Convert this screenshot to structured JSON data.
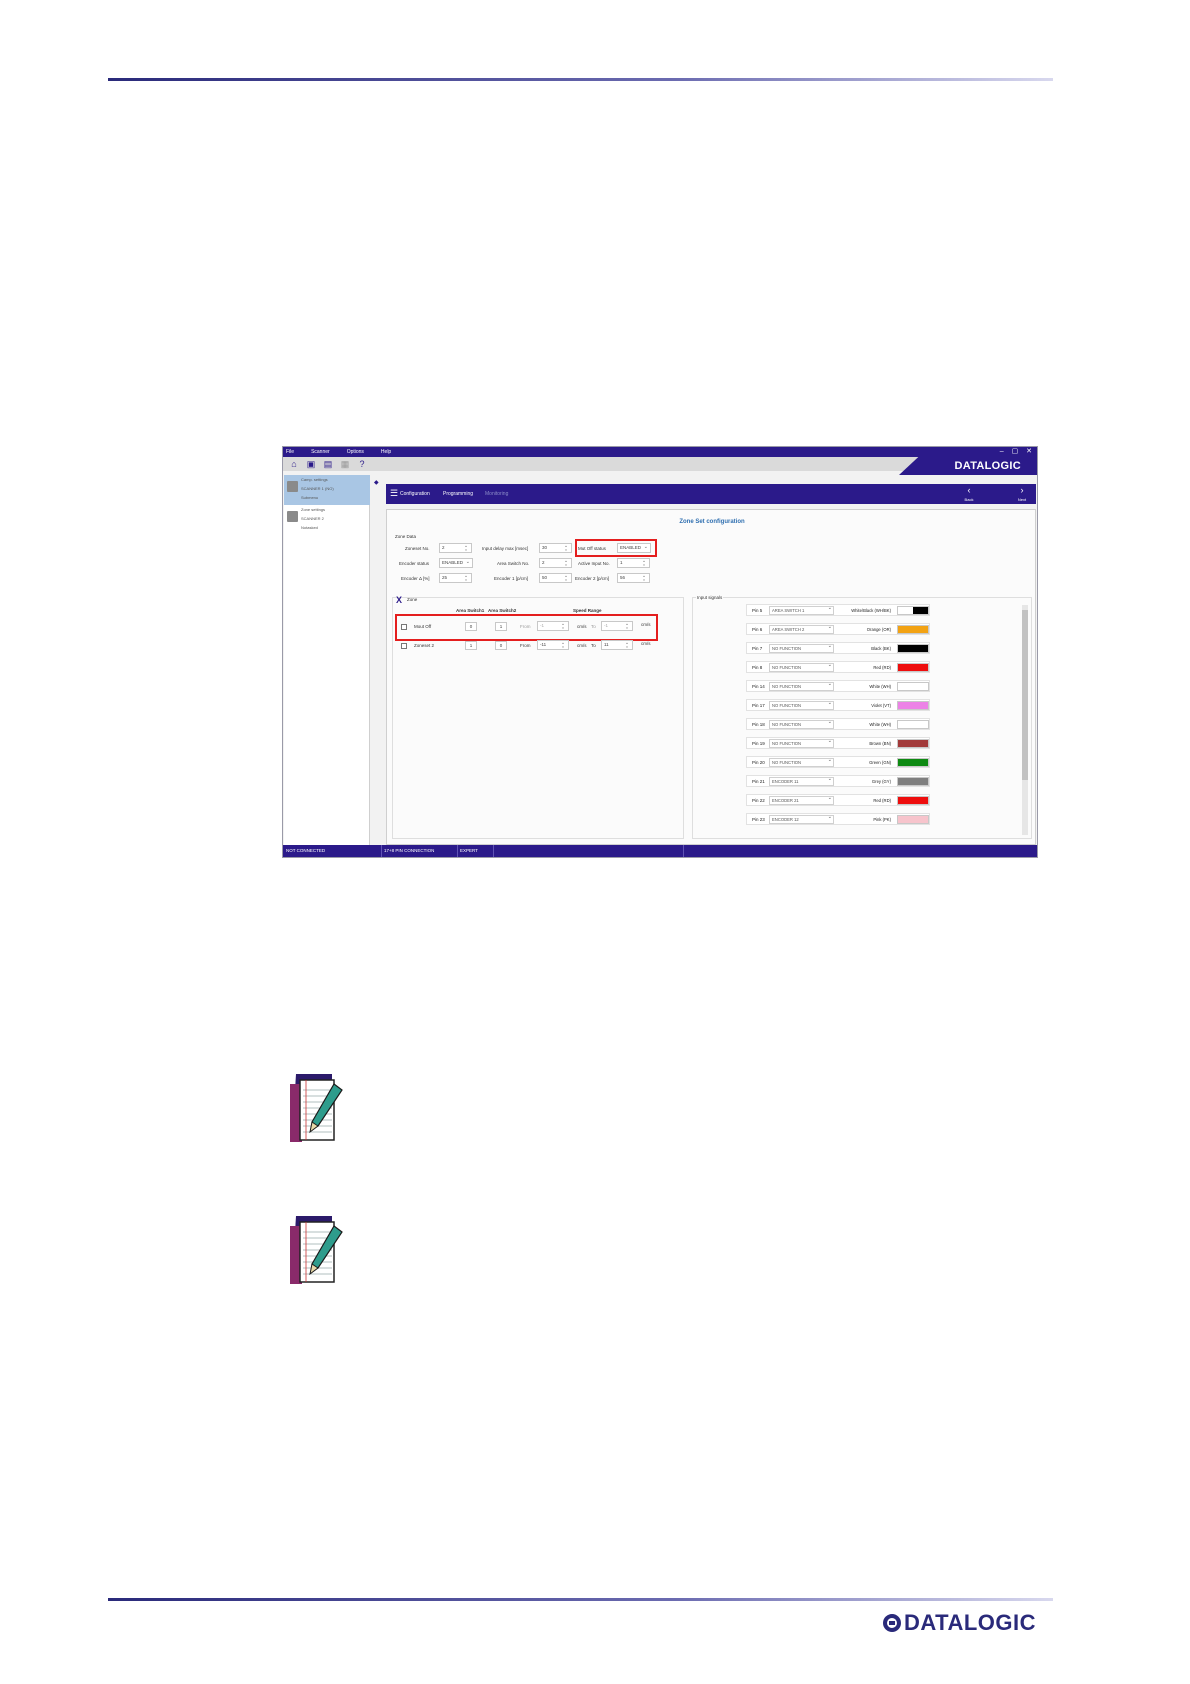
{
  "logo_text": "DATALOGIC",
  "app": {
    "menu": [
      "File",
      "Scanner",
      "Options",
      "Help"
    ],
    "window_controls": "– ▢ ✕",
    "brand": "DATALOGIC",
    "left_panel": [
      {
        "lines": [
          "Camp. settings",
          "SCANNER 1 (NO)",
          "Submenu"
        ]
      },
      {
        "lines": [
          "Zone settings",
          "SCANNER 2",
          "Notasked"
        ]
      }
    ],
    "nav": {
      "configuration": "Configuration",
      "programming": "Programming",
      "monitoring": "Monitoring",
      "back": "Back",
      "next": "Next"
    },
    "title": "Zone Set configuration",
    "zone_data_label": "Zone Data",
    "fields": {
      "zoneset_no": {
        "label": "Zoneset No.",
        "value": "2"
      },
      "input_delay": {
        "label": "Input delay max [msec]",
        "value": "30"
      },
      "muteoff_status": {
        "label": "Mut Off status",
        "value": "ENABLED"
      },
      "encoder_status": {
        "label": "Encoder status",
        "value": "ENABLED"
      },
      "area_switch_no": {
        "label": "Area Switch No.",
        "value": "2"
      },
      "active_input_no": {
        "label": "Active Input No.",
        "value": "1"
      },
      "encoder_delta": {
        "label": "Encoder Δ [%]",
        "value": "25"
      },
      "encoder1": {
        "label": "Encoder 1 [p/cm]",
        "value": "50"
      },
      "encoder2": {
        "label": "Encoder 2 [p/cm]",
        "value": "56"
      }
    },
    "zone_section": {
      "title": "Zone",
      "headers": {
        "as1": "Area Switch1",
        "as2": "Area Switch2",
        "speed": "Speed Range"
      },
      "rows": [
        {
          "name": "Mout Off",
          "as1": "0",
          "as2": "1",
          "from_label": "From",
          "from": "-1",
          "unit": "cm/s",
          "to_label": "To",
          "to": "-1",
          "unit2": "cm/s"
        },
        {
          "name": "Zoneset 2",
          "as1": "1",
          "as2": "0",
          "from_label": "From",
          "from": "-11",
          "unit": "cm/s",
          "to_label": "To",
          "to": "11",
          "unit2": "cm/s"
        }
      ]
    },
    "input_signals_label": "Input signals",
    "pins": [
      {
        "pin": "Pin 5",
        "func": "AREA SWITCH 1",
        "color_name": "White/Black (WH/BK)",
        "c1": "#ffffff",
        "c2": "#000000"
      },
      {
        "pin": "Pin 6",
        "func": "AREA SWITCH 2",
        "color_name": "Orange (OR)",
        "c1": "#f2a213",
        "c2": "#f2a213"
      },
      {
        "pin": "Pin 7",
        "func": "NO FUNCTION",
        "color_name": "Black (BK)",
        "c1": "#000000",
        "c2": "#000000"
      },
      {
        "pin": "Pin 8",
        "func": "NO FUNCTION",
        "color_name": "Red (RD)",
        "c1": "#ee0d0d",
        "c2": "#ee0d0d"
      },
      {
        "pin": "Pin 14",
        "func": "NO FUNCTION",
        "color_name": "White (WH)",
        "c1": "#ffffff",
        "c2": "#ffffff"
      },
      {
        "pin": "Pin 17",
        "func": "NO FUNCTION",
        "color_name": "Violet (VT)",
        "c1": "#ec82e6",
        "c2": "#ec82e6"
      },
      {
        "pin": "Pin 18",
        "func": "NO FUNCTION",
        "color_name": "White (WH)",
        "c1": "#ffffff",
        "c2": "#ffffff"
      },
      {
        "pin": "Pin 19",
        "func": "NO FUNCTION",
        "color_name": "Brown (BN)",
        "c1": "#a23a3a",
        "c2": "#a23a3a"
      },
      {
        "pin": "Pin 20",
        "func": "NO FUNCTION",
        "color_name": "Green (GN)",
        "c1": "#0e8a12",
        "c2": "#0e8a12"
      },
      {
        "pin": "Pin 21",
        "func": "ENCODER 11",
        "color_name": "Grey (GY)",
        "c1": "#7f7f7f",
        "c2": "#7f7f7f"
      },
      {
        "pin": "Pin 22",
        "func": "ENCODER 21",
        "color_name": "Red (RD)",
        "c1": "#ee0d0d",
        "c2": "#ee0d0d"
      },
      {
        "pin": "Pin 23",
        "func": "ENCODER 12",
        "color_name": "Pink (PK)",
        "c1": "#f7c4cc",
        "c2": "#f7c4cc"
      }
    ],
    "status": {
      "connection": "NOT CONNECTED",
      "pins": "17+8 PIN CONNECTION",
      "mode": "EXPERT"
    }
  }
}
